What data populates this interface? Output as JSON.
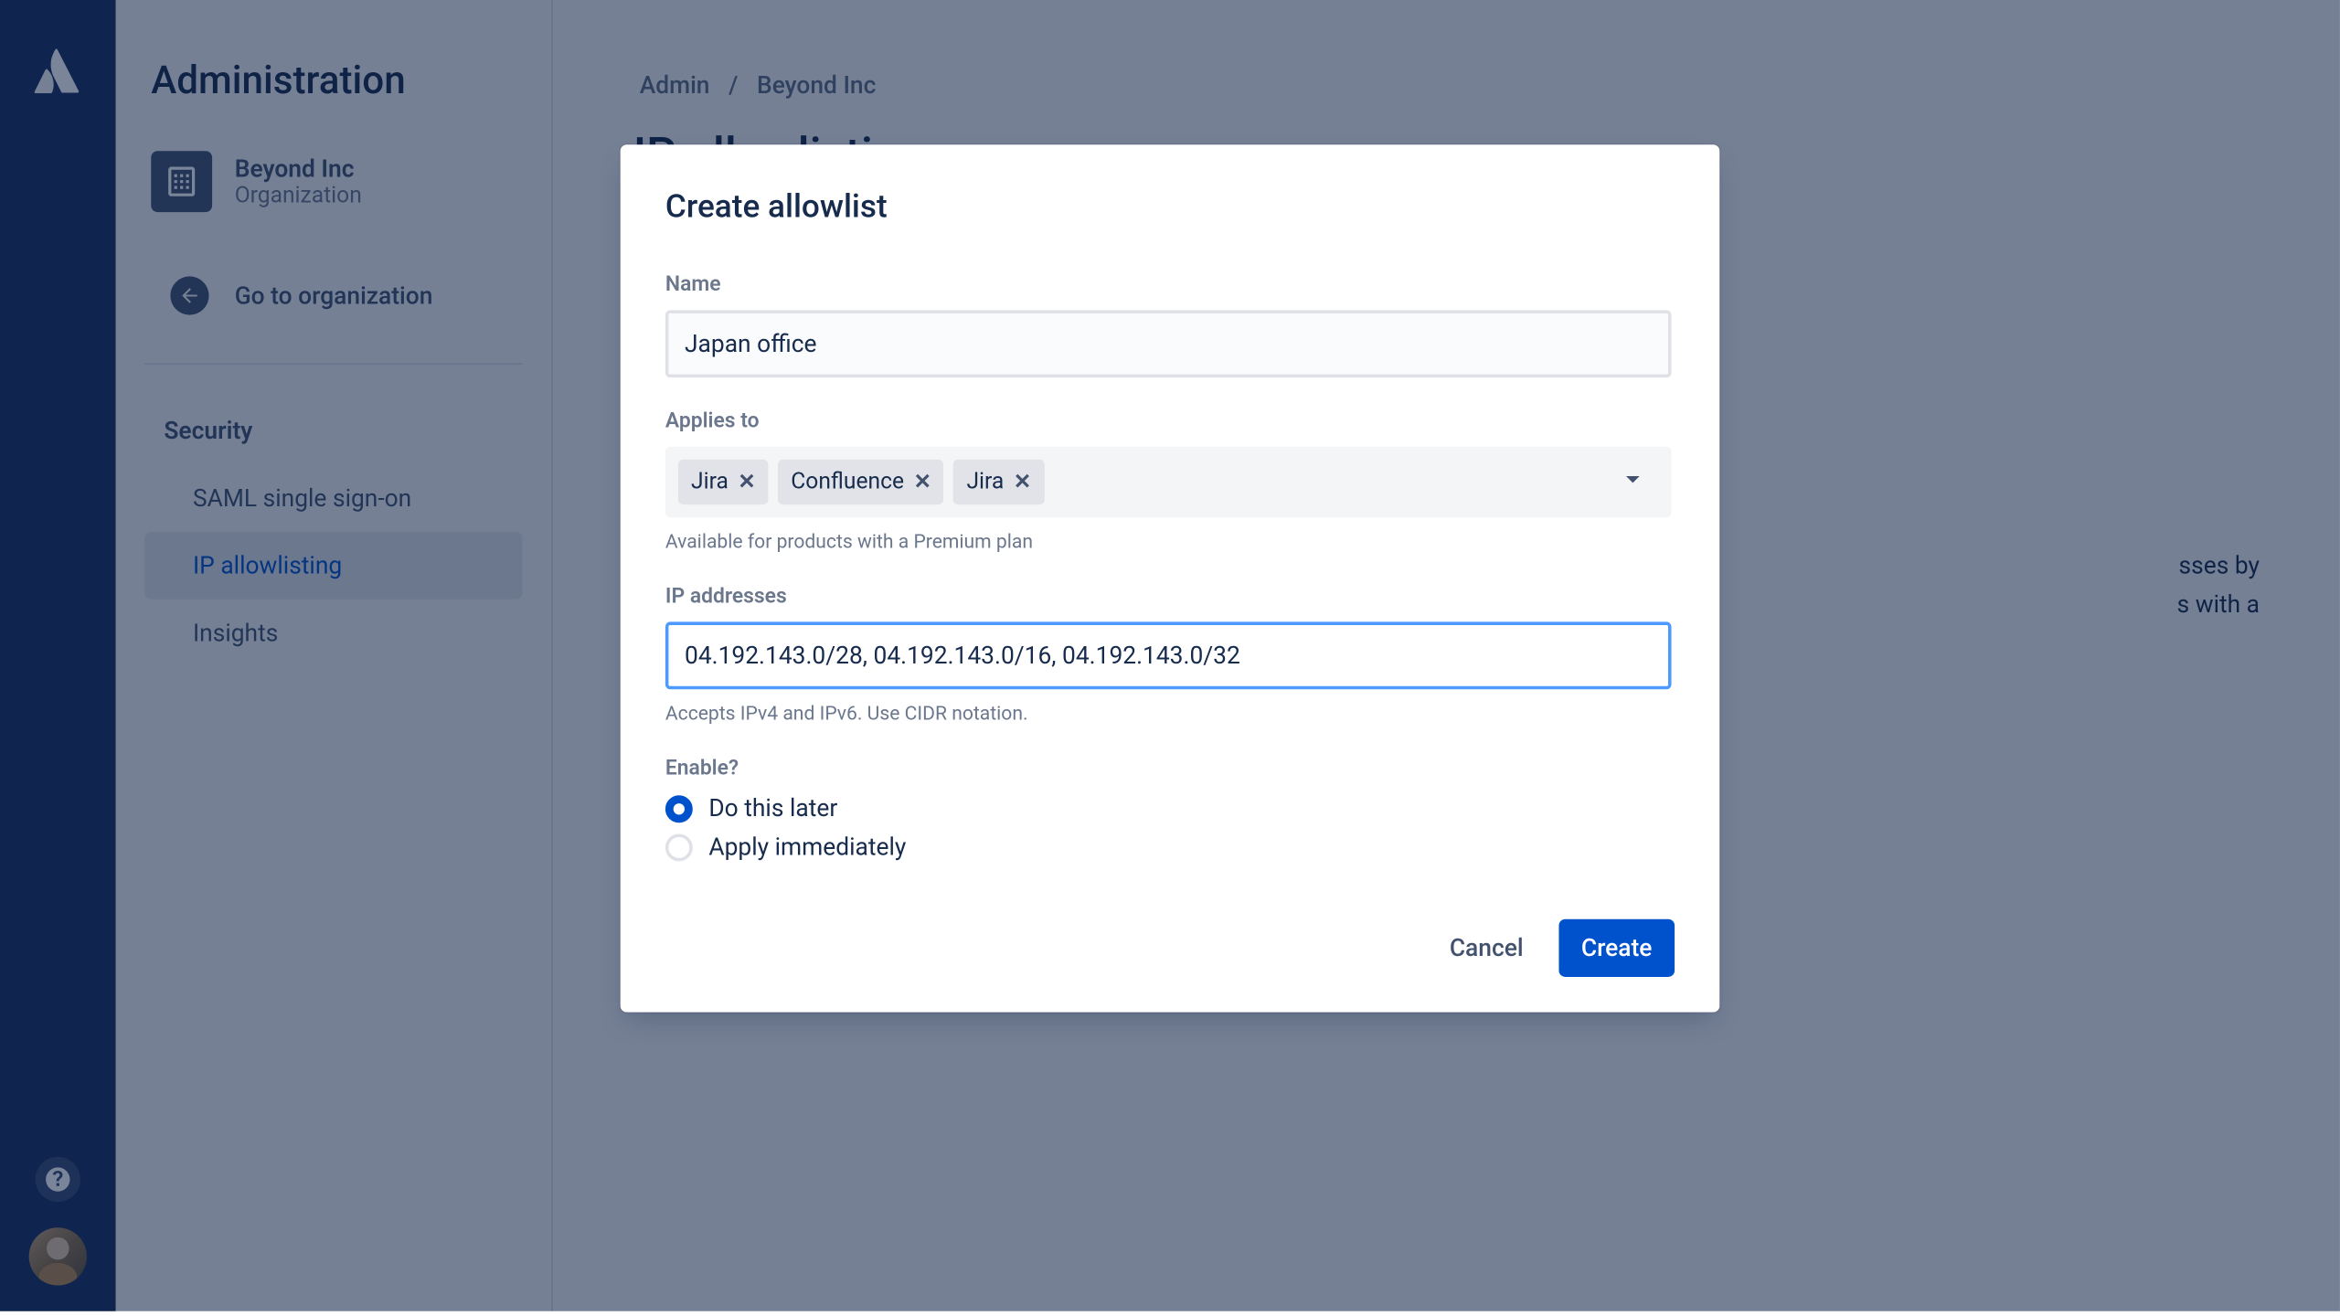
{
  "sidebar": {
    "title": "Administration",
    "org": {
      "name": "Beyond Inc",
      "subtitle": "Organization"
    },
    "go_to_org": "Go to organization",
    "section_heading": "Security",
    "items": [
      {
        "label": "SAML single sign-on"
      },
      {
        "label": "IP allowlisting"
      },
      {
        "label": "Insights"
      }
    ]
  },
  "breadcrumb": {
    "part1": "Admin",
    "sep": "/",
    "part2": "Beyond Inc"
  },
  "page": {
    "title": "IP allowlisting"
  },
  "bg_text": {
    "line1": "sses by",
    "line2": "s with a"
  },
  "modal": {
    "title": "Create allowlist",
    "name": {
      "label": "Name",
      "value": "Japan office"
    },
    "applies_to": {
      "label": "Applies to",
      "tags": [
        "Jira",
        "Confluence",
        "Jira"
      ],
      "helper": "Available for products with a Premium plan"
    },
    "ips": {
      "label": "IP addresses",
      "value": "04.192.143.0/28, 04.192.143.0/16, 04.192.143.0/32",
      "helper": "Accepts IPv4 and IPv6. Use CIDR notation."
    },
    "enable": {
      "label": "Enable?",
      "options": [
        {
          "label": "Do this later",
          "checked": true
        },
        {
          "label": "Apply immediately",
          "checked": false
        }
      ]
    },
    "actions": {
      "cancel": "Cancel",
      "create": "Create"
    }
  }
}
